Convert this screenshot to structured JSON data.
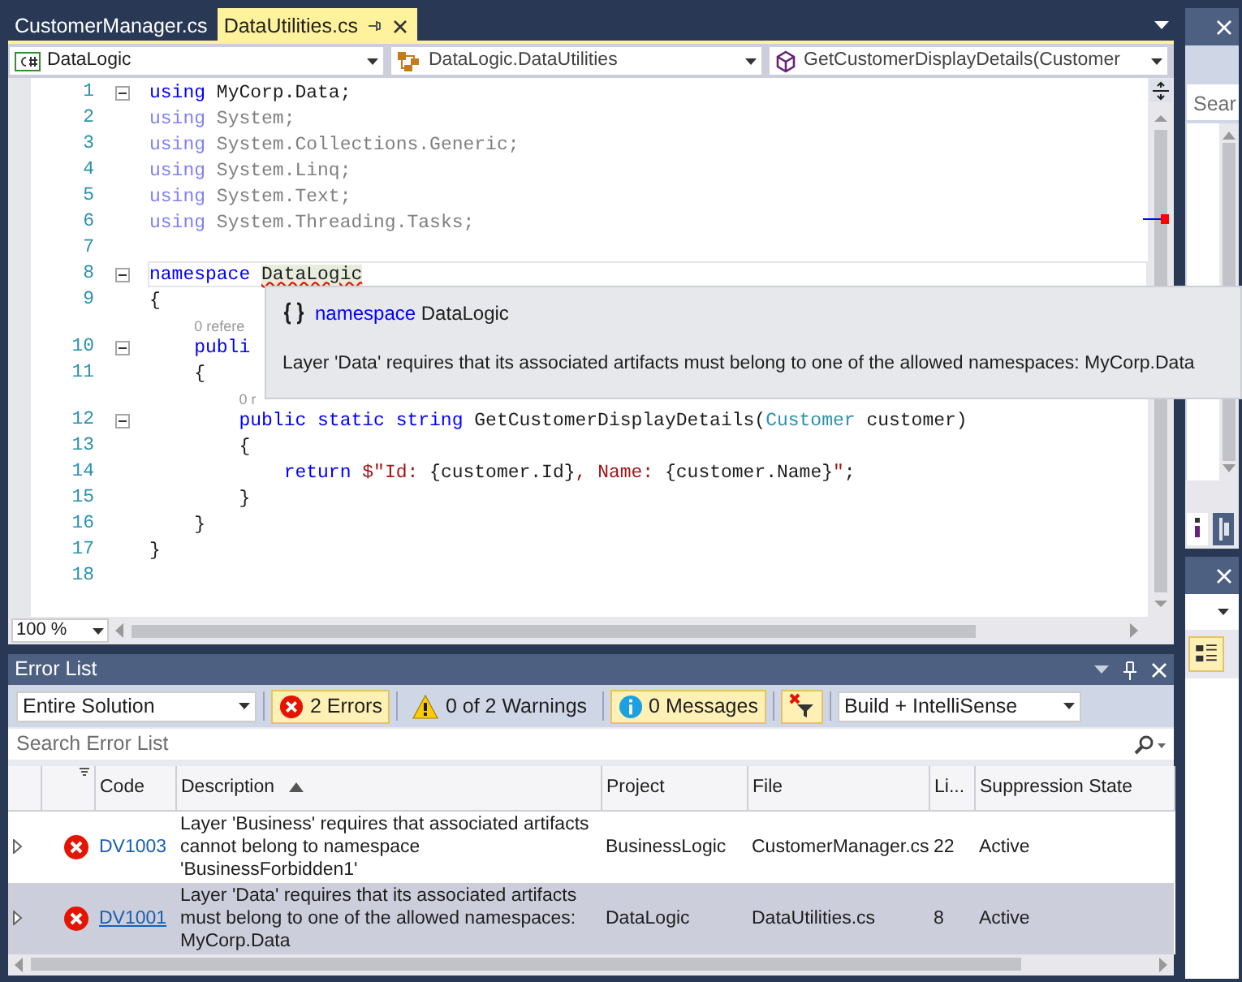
{
  "editor_tabs": [
    {
      "label": "CustomerManager.cs",
      "selected": false
    },
    {
      "label": "DataUtilities.cs",
      "selected": true
    }
  ],
  "navigation_bar": [
    {
      "kind": "project",
      "label": "DataLogic"
    },
    {
      "kind": "type",
      "label": "DataLogic.DataUtilities"
    },
    {
      "kind": "member",
      "label": "GetCustomerDisplayDetails(Customer"
    }
  ],
  "code_lines": [
    {
      "number": "1",
      "fold_marker": true,
      "current": false,
      "tokens": [
        {
          "kind": "keyword",
          "text": "using"
        },
        {
          "kind": "plain",
          "text": " MyCorp.Data;"
        }
      ]
    },
    {
      "number": "2",
      "fold_marker": false,
      "current": false,
      "tokens": [
        {
          "kind": "keyword_faded",
          "text": "using"
        },
        {
          "kind": "faded",
          "text": " System;"
        }
      ]
    },
    {
      "number": "3",
      "fold_marker": false,
      "current": false,
      "tokens": [
        {
          "kind": "keyword_faded",
          "text": "using"
        },
        {
          "kind": "faded",
          "text": " System.Collections.Generic;"
        }
      ]
    },
    {
      "number": "4",
      "fold_marker": false,
      "current": false,
      "tokens": [
        {
          "kind": "keyword_faded",
          "text": "using"
        },
        {
          "kind": "faded",
          "text": " System.Linq;"
        }
      ]
    },
    {
      "number": "5",
      "fold_marker": false,
      "current": false,
      "tokens": [
        {
          "kind": "keyword_faded",
          "text": "using"
        },
        {
          "kind": "faded",
          "text": " System.Text;"
        }
      ]
    },
    {
      "number": "6",
      "fold_marker": false,
      "current": false,
      "tokens": [
        {
          "kind": "keyword_faded",
          "text": "using"
        },
        {
          "kind": "faded",
          "text": " System.Threading.Tasks;"
        }
      ]
    },
    {
      "number": "7",
      "fold_marker": false,
      "current": false
    },
    {
      "number": "8",
      "fold_marker": true,
      "current": true,
      "tokens": [
        {
          "kind": "keyword",
          "text": "namespace "
        },
        {
          "kind": "error",
          "text": "DataLogic"
        }
      ]
    },
    {
      "number": "9",
      "fold_marker": false,
      "current": false,
      "tokens": [
        {
          "kind": "plain",
          "text": "{"
        }
      ]
    },
    {
      "number": "10",
      "fold_marker": true,
      "current": false,
      "codelens": "0 refere",
      "tokens": [
        {
          "kind": "keyword",
          "text": "    publi"
        }
      ]
    },
    {
      "number": "11",
      "fold_marker": false,
      "current": false,
      "tokens": [
        {
          "kind": "plain",
          "text": "    {"
        }
      ]
    },
    {
      "number": "12",
      "fold_marker": true,
      "current": false,
      "codelens": "0 r",
      "tokens": [
        {
          "kind": "keyword",
          "text": "        public static string"
        },
        {
          "kind": "plain",
          "text": " GetCustomerDisplayDetails("
        },
        {
          "kind": "type",
          "text": "Customer"
        },
        {
          "kind": "plain",
          "text": " customer)"
        }
      ]
    },
    {
      "number": "13",
      "fold_marker": false,
      "current": false,
      "tokens": [
        {
          "kind": "plain",
          "text": "        {"
        }
      ]
    },
    {
      "number": "14",
      "fold_marker": false,
      "current": false,
      "tokens": [
        {
          "kind": "keyword",
          "text": "            return"
        },
        {
          "kind": "string",
          "text": " $\"Id: "
        },
        {
          "kind": "plain",
          "text": "{customer.Id}"
        },
        {
          "kind": "string",
          "text": ", Name: "
        },
        {
          "kind": "plain",
          "text": "{customer.Name}"
        },
        {
          "kind": "string",
          "text": "\""
        },
        {
          "kind": "plain",
          "text": ";"
        }
      ]
    },
    {
      "number": "15",
      "fold_marker": false,
      "current": false,
      "tokens": [
        {
          "kind": "plain",
          "text": "        }"
        }
      ]
    },
    {
      "number": "16",
      "fold_marker": false,
      "current": false,
      "tokens": [
        {
          "kind": "plain",
          "text": "    }"
        }
      ]
    },
    {
      "number": "17",
      "fold_marker": false,
      "current": false,
      "tokens": [
        {
          "kind": "plain",
          "text": "}"
        }
      ]
    },
    {
      "number": "18",
      "fold_marker": false,
      "current": false
    }
  ],
  "quick_info": {
    "keyword": "namespace",
    "name": "DataLogic",
    "message": "Layer 'Data' requires that its associated artifacts must belong to one of the allowed namespaces: MyCorp.Data"
  },
  "zoom_level": "100 %",
  "side_panel": {
    "search_placeholder": "Sear"
  },
  "error_list": {
    "title": "Error List",
    "scope": "Entire Solution",
    "filters": [
      {
        "kind": "errors",
        "label": "2 Errors",
        "selected": true
      },
      {
        "kind": "warnings",
        "label": "0 of 2 Warnings",
        "selected": false
      },
      {
        "kind": "messages",
        "label": "0 Messages",
        "selected": true
      }
    ],
    "clear_filter_selected": true,
    "source": "Build + IntelliSense",
    "search_placeholder": "Search Error List",
    "columns": [
      {
        "kind": "expander"
      },
      {
        "kind": "severity"
      },
      {
        "kind": "text",
        "label": "Code",
        "sorted": false
      },
      {
        "kind": "text",
        "label": "Description",
        "sorted": true
      },
      {
        "kind": "text",
        "label": "Project",
        "sorted": false
      },
      {
        "kind": "text",
        "label": "File",
        "sorted": false
      },
      {
        "kind": "text",
        "label": "Li...",
        "sorted": false
      },
      {
        "kind": "text",
        "label": "Suppression State",
        "sorted": false
      }
    ],
    "rows": [
      {
        "code": "DV1003",
        "description": "Layer 'Business' requires that associated artifacts cannot belong to namespace 'BusinessForbidden1'",
        "project": "BusinessLogic",
        "file": "CustomerManager.cs",
        "line": "22",
        "suppression_state": "Active",
        "selected": false
      },
      {
        "code": "DV1001",
        "description": "Layer 'Data' requires that its associated artifacts must belong to one of the allowed namespaces: MyCorp.Data",
        "project": "DataLogic",
        "file": "DataUtilities.cs",
        "line": "8",
        "suppression_state": "Active",
        "selected": true
      }
    ]
  }
}
